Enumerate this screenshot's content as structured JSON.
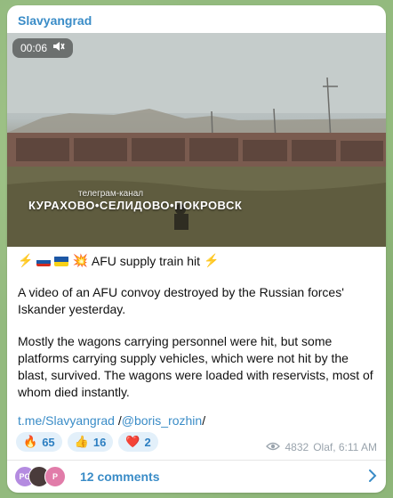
{
  "post": {
    "channel_name": "Slavyangrad",
    "video": {
      "timecode": "00:06",
      "watermark_line1": "телеграм-канал",
      "watermark_line2": "КУРАХОВО•СЕЛИДОВО•ПОКРОВСК"
    },
    "headline": "AFU supply train hit",
    "paragraph1": "A video of an AFU convoy destroyed by the Russian forces' Iskander yesterday.",
    "paragraph2": "Mostly the wagons carrying personnel were hit, but some platforms carrying supply vehicles, which were not hit by the blast, survived. The wagons were loaded with reservists, most of whom died instantly.",
    "link1": "t.me/Slavyangrad",
    "link_separator": " /",
    "link2": "@boris_rozhin",
    "link_suffix": "/",
    "reactions": [
      {
        "emoji": "🔥",
        "count": "65"
      },
      {
        "emoji": "👍",
        "count": "16"
      },
      {
        "emoji": "❤️",
        "count": "2"
      }
    ],
    "views": "4832",
    "author_time": "Olaf, 6:11 AM",
    "comments_label": "12 comments",
    "comment_avatars": [
      "PG",
      "",
      "P"
    ]
  },
  "colors": {
    "accent": "#3a8cc7",
    "background": "#93ba7e"
  },
  "icons": {
    "mute": "speaker-muted-icon",
    "views": "eye-icon",
    "chevron": "chevron-right-icon"
  }
}
